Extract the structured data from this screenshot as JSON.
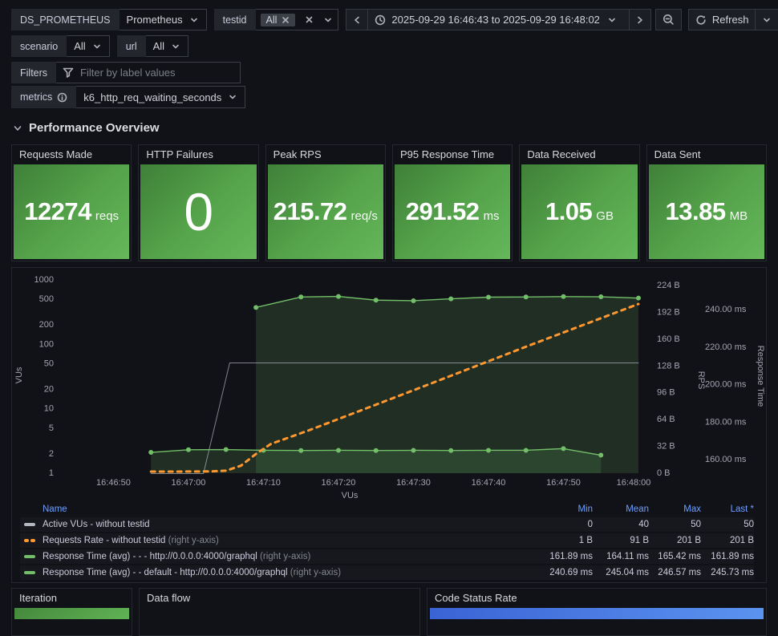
{
  "header": {
    "datasource": {
      "label": "DS_PROMETHEUS",
      "value": "Prometheus"
    },
    "testid": {
      "label": "testid",
      "chip": "All"
    },
    "scenario": {
      "label": "scenario",
      "value": "All"
    },
    "url": {
      "label": "url",
      "value": "All"
    },
    "filters": {
      "label": "Filters",
      "placeholder": "Filter by label values"
    },
    "metrics": {
      "label": "metrics",
      "value": "k6_http_req_waiting_seconds"
    },
    "time": {
      "range": "2025-09-29 16:46:43 to 2025-09-29 16:48:02",
      "refresh_label": "Refresh"
    }
  },
  "section": {
    "title": "Performance Overview"
  },
  "stats": [
    {
      "title": "Requests Made",
      "value": "12274",
      "unit": "reqs"
    },
    {
      "title": "HTTP Failures",
      "value": "0",
      "unit": ""
    },
    {
      "title": "Peak RPS",
      "value": "215.72",
      "unit": "req/s"
    },
    {
      "title": "P95 Response Time",
      "value": "291.52",
      "unit": "ms"
    },
    {
      "title": "Data Received",
      "value": "1.05",
      "unit": "GB"
    },
    {
      "title": "Data Sent",
      "value": "13.85",
      "unit": "MB"
    }
  ],
  "chart_data": {
    "type": "line",
    "xlabel": "VUs",
    "time_start": "16:46:43",
    "time_span_seconds": 77,
    "x_ticks": [
      {
        "t": 7,
        "label": "16:46:50"
      },
      {
        "t": 17,
        "label": "16:47:00"
      },
      {
        "t": 27,
        "label": "16:47:10"
      },
      {
        "t": 37,
        "label": "16:47:20"
      },
      {
        "t": 47,
        "label": "16:47:30"
      },
      {
        "t": 57,
        "label": "16:47:40"
      },
      {
        "t": 67,
        "label": "16:47:50"
      },
      {
        "t": 77,
        "label": "16:48:00"
      }
    ],
    "left_axis": {
      "label": "VUs",
      "scale": "log",
      "ticks": [
        1000,
        500,
        200,
        100,
        50,
        20,
        10,
        5,
        2,
        1
      ]
    },
    "right_axis_rps": {
      "label": "RPS",
      "ticks": [
        {
          "label": "224 B",
          "value": 224
        },
        {
          "label": "192 B",
          "value": 192
        },
        {
          "label": "160 B",
          "value": 160
        },
        {
          "label": "128 B",
          "value": 128
        },
        {
          "label": "96 B",
          "value": 96
        },
        {
          "label": "64 B",
          "value": 64
        },
        {
          "label": "32 B",
          "value": 32
        },
        {
          "label": "0 B",
          "value": 0
        }
      ]
    },
    "right_axis_rt": {
      "label": "Response Time",
      "ticks": [
        {
          "label": "240.00 ms",
          "value": 240
        },
        {
          "label": "220.00 ms",
          "value": 220
        },
        {
          "label": "200.00 ms",
          "value": 200
        },
        {
          "label": "180.00 ms",
          "value": 180
        },
        {
          "label": "160.00 ms",
          "value": 160
        }
      ]
    },
    "series": [
      {
        "name": "Active VUs - without testid",
        "axis": "vus",
        "color": "rgba(204,204,220,0.6)",
        "style": "solid",
        "width": 1,
        "dots": false,
        "fill": false,
        "points": [
          [
            12,
            0
          ],
          [
            19,
            0
          ],
          [
            22.5,
            50
          ],
          [
            77,
            50
          ]
        ]
      },
      {
        "name": "Response Time (avg) - - - http://0.0.0.0:4000/graphql",
        "axis": "rt",
        "color": "#73bf69",
        "style": "solid",
        "width": 1.4,
        "dots": true,
        "fill": true,
        "points": [
          [
            12,
            163.4
          ],
          [
            17,
            164.8
          ],
          [
            22,
            164.9
          ],
          [
            27,
            164.5
          ],
          [
            32,
            164.4
          ],
          [
            37,
            164.5
          ],
          [
            42,
            164.4
          ],
          [
            47,
            164.5
          ],
          [
            52,
            164.4
          ],
          [
            57,
            164.5
          ],
          [
            62,
            164.5
          ],
          [
            67,
            165.4
          ],
          [
            72,
            161.9
          ]
        ]
      },
      {
        "name": "Response Time (avg) - - default - http://0.0.0.0:4000/graphql",
        "axis": "rt",
        "color": "#73bf69",
        "style": "solid",
        "width": 1.4,
        "dots": true,
        "fill": true,
        "points": [
          [
            26,
            240.7
          ],
          [
            32,
            246.3
          ],
          [
            37,
            246.6
          ],
          [
            42,
            244.6
          ],
          [
            47,
            244.3
          ],
          [
            52,
            245.3
          ],
          [
            57,
            246.2
          ],
          [
            62,
            246.3
          ],
          [
            67,
            246.5
          ],
          [
            72,
            246.4
          ],
          [
            77,
            245.7
          ]
        ]
      },
      {
        "name": "Requests Rate - without testid",
        "axis": "rps",
        "color": "#ff9830",
        "style": "dashed",
        "width": 3,
        "dots": false,
        "fill": false,
        "points": [
          [
            12,
            1
          ],
          [
            16,
            1
          ],
          [
            20,
            1.2
          ],
          [
            22,
            2
          ],
          [
            24,
            8
          ],
          [
            26,
            22
          ],
          [
            28,
            34
          ],
          [
            33,
            50
          ],
          [
            47,
            98
          ],
          [
            62,
            150
          ],
          [
            77,
            201
          ]
        ]
      }
    ],
    "fill_color": "rgba(115,191,105,0.16)"
  },
  "legend": {
    "columns": [
      "Name",
      "Min",
      "Mean",
      "Max",
      "Last *"
    ],
    "rows": [
      {
        "name": "Active VUs - without testid",
        "suffix": "",
        "min": "0",
        "mean": "40",
        "max": "50",
        "last": "50"
      },
      {
        "name": "Requests Rate - without testid ",
        "suffix": "(right y-axis)",
        "min": "1 B",
        "mean": "91 B",
        "max": "201 B",
        "last": "201 B"
      },
      {
        "name": "Response Time (avg) - - - http://0.0.0.0:4000/graphql ",
        "suffix": "(right y-axis)",
        "min": "161.89 ms",
        "mean": "164.11 ms",
        "max": "165.42 ms",
        "last": "161.89 ms"
      },
      {
        "name": "Response Time (avg) - - default - http://0.0.0.0:4000/graphql ",
        "suffix": "(right y-axis)",
        "min": "240.69 ms",
        "mean": "245.04 ms",
        "max": "246.57 ms",
        "last": "245.73 ms"
      }
    ]
  },
  "bottom_panels": [
    {
      "title": "Iteration"
    },
    {
      "title": "Data flow"
    },
    {
      "title": "Code Status Rate"
    }
  ],
  "colors": {
    "background": "#111217",
    "panel_border": "#25282f",
    "green_series": "#73bf69",
    "orange_series": "#ff9830",
    "gray_series": "#ccccdc",
    "legend_header_blue": "#6e9fff",
    "stat_green_gradient": [
      "#3f8038",
      "#65b75a"
    ],
    "code_status_blue_gradient": [
      "#3a63d4",
      "#5b93f0"
    ]
  }
}
